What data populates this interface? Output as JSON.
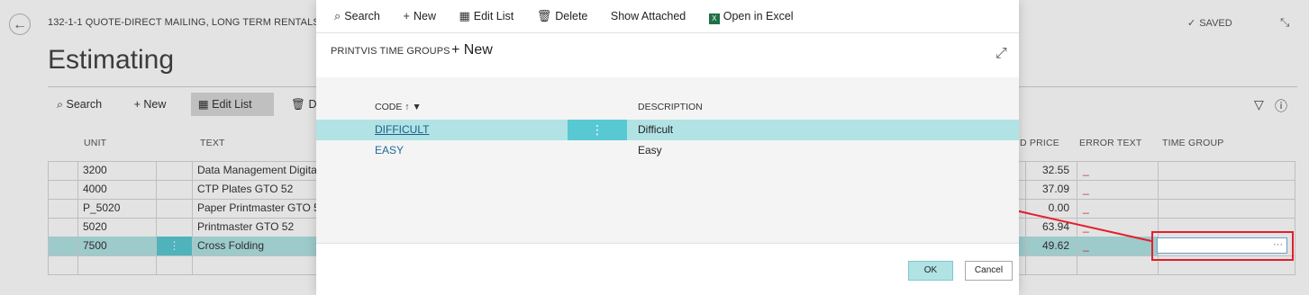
{
  "page": {
    "back_icon": "back-arrow-icon",
    "breadcrumb": "132-1-1 QUOTE-DIRECT MAILING, LONG TERM RENTALS",
    "title": "Estimating",
    "saved_label": "SAVED",
    "toolbar": [
      "Search",
      "New",
      "Edit List",
      "Delete"
    ],
    "columns": {
      "unit": "UNIT",
      "text": "TEXT",
      "price": "D PRICE",
      "error_text": "ERROR TEXT",
      "time_group": "TIME GROUP"
    },
    "rows": [
      {
        "unit": "3200",
        "text": "Data Management Digita",
        "price": "32.55",
        "error": "_"
      },
      {
        "unit": "4000",
        "text": "CTP Plates GTO 52",
        "price": "37.09",
        "error": "_"
      },
      {
        "unit": "P_5020",
        "text": "Paper Printmaster GTO 5",
        "price": "0.00",
        "error": "_"
      },
      {
        "unit": "5020",
        "text": "Printmaster GTO 52",
        "price": "63.94",
        "error": "_"
      },
      {
        "unit": "7500",
        "text": "Cross Folding",
        "price": "49.62",
        "error": "_",
        "selected": true
      },
      {
        "unit": "",
        "text": "",
        "price": "",
        "error": ""
      }
    ],
    "time_group_ellipsis": "···",
    "highlight_color": "#e31f2c"
  },
  "modal": {
    "toolbar": {
      "search": "Search",
      "new": "New",
      "edit_list": "Edit List",
      "delete": "Delete",
      "show_attached": "Show Attached",
      "open_in_excel": "Open in Excel"
    },
    "title": "PRINTVIS TIME GROUPS",
    "new_label": "New",
    "columns": {
      "code": "CODE ↑ ▼",
      "description": "DESCRIPTION"
    },
    "rows": [
      {
        "code": "DIFFICULT",
        "description": "Difficult",
        "selected": true
      },
      {
        "code": "EASY",
        "description": "Easy"
      }
    ],
    "ok_label": "OK",
    "cancel_label": "Cancel",
    "accent_color": "#b1e3e5"
  }
}
